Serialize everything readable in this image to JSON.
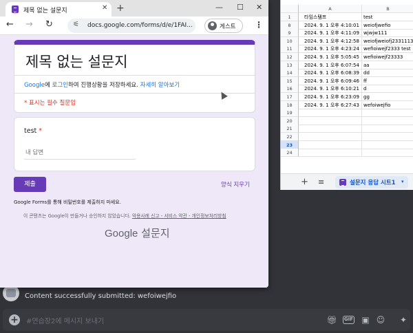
{
  "browser": {
    "tab_title": "제목 없는 설문지",
    "url": "docs.google.com/forms/d/e/1FAI...",
    "profile_label": "게스트",
    "new_tab_glyph": "+",
    "close_glyph": "✕",
    "minimize_glyph": "—",
    "maximize_glyph": "☐",
    "window_close_glyph": "✕",
    "back_glyph": "←",
    "forward_glyph": "→",
    "reload_glyph": "↻",
    "tune_glyph": "⚟",
    "menu_glyph": "⋮"
  },
  "form": {
    "title": "제목 없는 설문지",
    "login_note_prefix": "Google에 로그인하여 진행상황을 저장하세요. ",
    "login_link": "자세히 알아보기",
    "required_note": "* 표시는 필수 질문임",
    "question_label": "test",
    "required_star": " *",
    "answer_placeholder": "내 답변",
    "submit_label": "제출",
    "clear_label": "양식 지우기",
    "password_note": "Google Forms를 통해 비밀번호를 제출하지 마세요.",
    "footer_prefix": "이 콘텐츠는 Google이 만들거나 승인하지 않았습니다. ",
    "footer_links": "악용사례 신고 - 서비스 약관 - 개인정보처리방침",
    "brand_google": "Google",
    "brand_forms": " 설문지",
    "theme_color": "#673ab7"
  },
  "sheet": {
    "col_headers": [
      "A",
      "B"
    ],
    "rows": [
      {
        "n": "1",
        "a": "타임스탬프",
        "b": "test"
      },
      {
        "n": "8",
        "a": "2024. 9. 1 오후 4:10:01",
        "b": "weiofjwefio"
      },
      {
        "n": "9",
        "a": "2024. 9. 1 오후 4:11:09",
        "b": "wjwjw111"
      },
      {
        "n": "10",
        "a": "2024. 9. 1 오후 4:12:58",
        "b": "weiofjweiofj2331113"
      },
      {
        "n": "11",
        "a": "2024. 9. 1 오후 4:23:24",
        "b": "wefioiwejf2333 test"
      },
      {
        "n": "12",
        "a": "2024. 9. 1 오후 5:05:45",
        "b": "wefioiwejf23333"
      },
      {
        "n": "13",
        "a": "2024. 9. 1 오후 6:07:54",
        "b": "aa"
      },
      {
        "n": "14",
        "a": "2024. 9. 1 오후 6:08:39",
        "b": "dd"
      },
      {
        "n": "15",
        "a": "2024. 9. 1 오후 6:09:46",
        "b": "ff"
      },
      {
        "n": "16",
        "a": "2024. 9. 1 오후 6:10:21",
        "b": "d"
      },
      {
        "n": "17",
        "a": "2024. 9. 1 오후 6:23:09",
        "b": "gg"
      },
      {
        "n": "18",
        "a": "2024. 9. 1 오후 6:27:43",
        "b": "wefoiwejfio"
      },
      {
        "n": "19",
        "a": "",
        "b": ""
      },
      {
        "n": "20",
        "a": "",
        "b": ""
      },
      {
        "n": "21",
        "a": "",
        "b": ""
      },
      {
        "n": "22",
        "a": "",
        "b": ""
      },
      {
        "n": "23",
        "a": "",
        "b": ""
      },
      {
        "n": "24",
        "a": "",
        "b": ""
      }
    ],
    "selected_row": "23",
    "add_sheet_glyph": "+",
    "all_sheets_glyph": "≡",
    "active_sheet": "설문지 응답 시트1",
    "dropdown_glyph": "▾"
  },
  "discord": {
    "message_text": "Content successfully submitted: wefoiwejfio",
    "chat_placeholder": "#연습장2에 메시지 보내기",
    "attach_glyph": "+",
    "gif_label": "GIF"
  }
}
